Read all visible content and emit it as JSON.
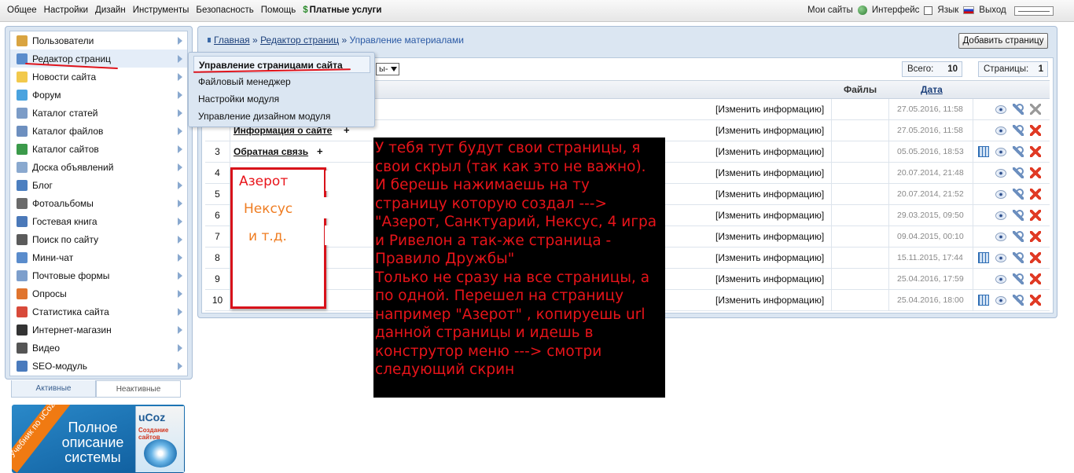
{
  "topbar": {
    "menu": [
      "Общее",
      "Настройки",
      "Дизайн",
      "Инструменты",
      "Безопасность",
      "Помощь"
    ],
    "paid": "Платные услуги",
    "right": {
      "my_sites": "Мои сайты",
      "interface": "Интерфейс",
      "language": "Язык",
      "logout": "Выход"
    }
  },
  "sidebar": {
    "items": [
      {
        "label": "Пользователи",
        "icon": "user-icon",
        "color": "#d9a441"
      },
      {
        "label": "Редактор страниц",
        "icon": "page-icon",
        "color": "#5a8ccc"
      },
      {
        "label": "Новости сайта",
        "icon": "bulb-icon",
        "color": "#f2c94c"
      },
      {
        "label": "Форум",
        "icon": "forum-icon",
        "color": "#4aa3df"
      },
      {
        "label": "Каталог статей",
        "icon": "articles-icon",
        "color": "#7c9cc7"
      },
      {
        "label": "Каталог файлов",
        "icon": "files-icon",
        "color": "#6d8fbf"
      },
      {
        "label": "Каталог сайтов",
        "icon": "globe-icon",
        "color": "#3b9a4a"
      },
      {
        "label": "Доска объявлений",
        "icon": "board-icon",
        "color": "#8aa9cf"
      },
      {
        "label": "Блог",
        "icon": "blog-icon",
        "color": "#4c7fc0"
      },
      {
        "label": "Фотоальбомы",
        "icon": "photo-icon",
        "color": "#6a6a6a"
      },
      {
        "label": "Гостевая книга",
        "icon": "guestbook-icon",
        "color": "#4b79b9"
      },
      {
        "label": "Поиск по сайту",
        "icon": "search-icon",
        "color": "#5b5b5b"
      },
      {
        "label": "Мини-чат",
        "icon": "chat-icon",
        "color": "#5a8ccc"
      },
      {
        "label": "Почтовые формы",
        "icon": "mail-icon",
        "color": "#7d9fcc"
      },
      {
        "label": "Опросы",
        "icon": "poll-icon",
        "color": "#e0742e"
      },
      {
        "label": "Статистика сайта",
        "icon": "stats-icon",
        "color": "#d84a3a"
      },
      {
        "label": "Интернет-магазин",
        "icon": "shop-icon",
        "color": "#333333"
      },
      {
        "label": "Видео",
        "icon": "video-icon",
        "color": "#555555"
      },
      {
        "label": "SEO-модуль",
        "icon": "seo-icon",
        "color": "#4a7bbd"
      }
    ],
    "tabs": {
      "active": "Активные",
      "inactive": "Неактивные"
    }
  },
  "banner": {
    "ribbon": "Учебник по uCoz",
    "text": "Полное описание системы",
    "brand": "uCoz",
    "subtitle": "Создание сайтов"
  },
  "submenu": [
    "Управление страницами сайта",
    "Файловый менеджер",
    "Настройки модуля",
    "Управление дизайном модуля"
  ],
  "breadcrumb": {
    "home": "Главная",
    "sep": "»",
    "editor": "Редактор страниц",
    "current": "Управление материалами"
  },
  "add_page": "Добавить страницу",
  "filter_text": "ы-",
  "counters": {
    "total_label": "Всего:",
    "total": "10",
    "pages_label": "Страницы:",
    "pages": "1"
  },
  "table": {
    "headers": {
      "files": "Файлы",
      "date": "Дата"
    },
    "edit_label": "[Изменить информацию]",
    "rows": [
      {
        "num": "",
        "title": "",
        "date": "27.05.2016, 11:58",
        "grid": false,
        "del_active": false
      },
      {
        "num": "",
        "title": "Информация о сайте",
        "date": "27.05.2016, 11:58",
        "grid": false,
        "del_active": true
      },
      {
        "num": "3",
        "title": "Обратная связь",
        "date": "05.05.2016, 18:53",
        "grid": true,
        "del_active": true
      },
      {
        "num": "4",
        "title": "",
        "date": "20.07.2014, 21:48",
        "grid": false,
        "del_active": true
      },
      {
        "num": "5",
        "title": "",
        "date": "20.07.2014, 21:52",
        "grid": false,
        "del_active": true
      },
      {
        "num": "6",
        "title": "",
        "date": "29.03.2015, 09:50",
        "grid": false,
        "del_active": true
      },
      {
        "num": "7",
        "title": "",
        "date": "09.04.2015, 00:10",
        "grid": false,
        "del_active": true
      },
      {
        "num": "8",
        "title": "",
        "date": "15.11.2015, 17:44",
        "grid": true,
        "del_active": true
      },
      {
        "num": "9",
        "title": "",
        "date": "25.04.2016, 17:59",
        "grid": false,
        "del_active": true
      },
      {
        "num": "10",
        "title": "",
        "date": "25.04.2016, 18:00",
        "grid": true,
        "del_active": true
      }
    ]
  },
  "annotation": {
    "box_lines": [
      "Азерот",
      "Нексус",
      "и т.д."
    ],
    "box_colors": [
      "#e8141a",
      "#ef7d22",
      "#ef7d22"
    ],
    "note": "У тебя тут будут свои страницы, я свои скрыл (так как это не важно).\nИ берешь нажимаешь на ту страницу которую создал ---> \"Азерот, Санктуарий, Нексус, 4 игра и Ривелон а так-же страница - Правило Дружбы\"\nТолько не сразу на все страницы, а по одной. Перешел на страницу например \"Азерот\" , копируешь url данной страницы и идешь в конструтор меню ---> смотри следующий скрин"
  }
}
